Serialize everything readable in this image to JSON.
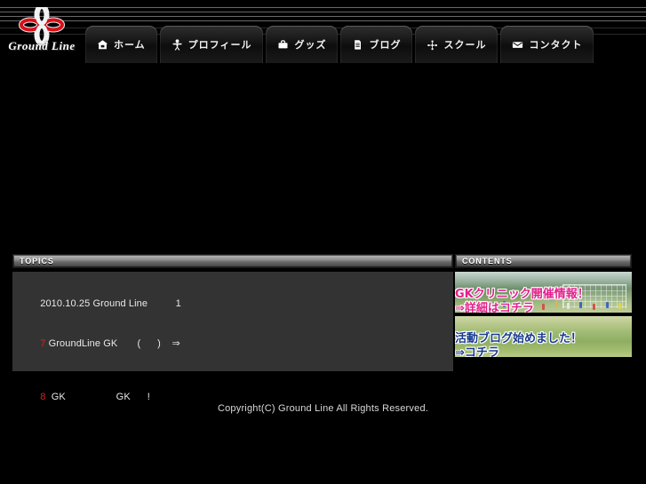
{
  "site": {
    "logo_text": "Ground Line",
    "logo_icon": "clover-flower-logo"
  },
  "nav": {
    "items": [
      {
        "label": "ホーム",
        "icon": "house-icon"
      },
      {
        "label": "プロフィール",
        "icon": "person-icon"
      },
      {
        "label": "グッズ",
        "icon": "bag-icon"
      },
      {
        "label": "ブログ",
        "icon": "document-icon"
      },
      {
        "label": "スクール",
        "icon": "network-icon"
      },
      {
        "label": "コンタクト",
        "icon": "envelope-icon"
      }
    ]
  },
  "topics": {
    "title": "TOPICS",
    "items": [
      {
        "text": "2010.10.25 Ground Line          1",
        "accent": ""
      },
      {
        "accent": "7",
        "text": " GroundLine GK       (      )    ⇒"
      },
      {
        "accent": "",
        "text": ""
      },
      {
        "accent": "8",
        "text": "  GK                  GK      !"
      }
    ]
  },
  "contents": {
    "title": "CONTENTS",
    "banners": [
      {
        "name": "gk-clinic-banner",
        "line1": "GKクリニック開催情報！",
        "line2": "⇒詳細はコチラ",
        "text_color": "#e0218a"
      },
      {
        "name": "blog-banner",
        "line1": "活動ブログ始めました！",
        "line2": "⇒コチラ",
        "text_color": "#173a8c"
      }
    ]
  },
  "footer": {
    "copyright": "Copyright(C) Ground Line All Rights Reserved."
  },
  "theme": {
    "background": "#000000",
    "panel_bg": "#333333",
    "accent_red": "#e02020",
    "text": "#e9e9e9"
  }
}
